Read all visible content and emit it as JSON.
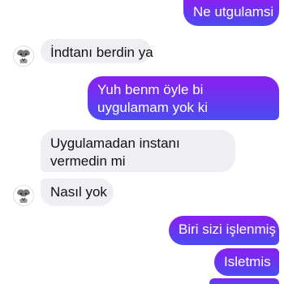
{
  "conversation": {
    "messages": [
      {
        "from": "me",
        "text": "Ne utgulamsi"
      },
      {
        "from": "them",
        "text": "İndtanı berdin ya"
      },
      {
        "from": "me",
        "text": "Yuh benm öyle bi uygulamam yok ki"
      },
      {
        "from": "them",
        "text": "Uygulamadan instanı vermedin mi"
      },
      {
        "from": "them",
        "text": "Nasıl yok"
      },
      {
        "from": "me",
        "text": "Biri sizi işlenmiş"
      },
      {
        "from": "me",
        "text": "Isletmis"
      }
    ]
  },
  "colors": {
    "outgoing_top": "#8a1ef0",
    "outgoing_bottom": "#4a4cf0",
    "incoming_bg": "#efeff3"
  },
  "icons": {
    "contact_avatar": "couple-sketch-avatar"
  }
}
